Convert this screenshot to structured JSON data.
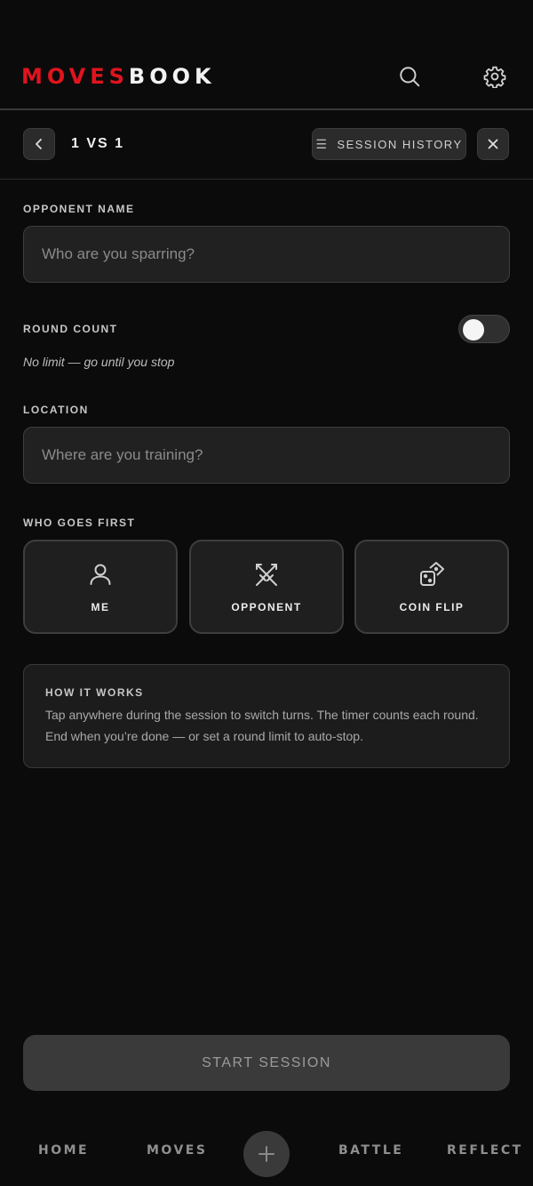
{
  "brand": {
    "part1": "MOVES",
    "part2": "BOOK",
    "accent": "#e0141e"
  },
  "header": {
    "search_icon": "search-icon",
    "settings_icon": "gear-icon"
  },
  "subbar": {
    "title": "1 VS 1",
    "history_label": "SESSION HISTORY",
    "back_icon": "chevron-left-icon",
    "close_icon": "close-icon"
  },
  "form": {
    "opponent": {
      "label": "OPPONENT NAME",
      "placeholder": "Who are you sparring?",
      "value": ""
    },
    "rounds": {
      "label": "ROUND COUNT",
      "enabled": false,
      "hint": "No limit — go until you stop"
    },
    "location": {
      "label": "LOCATION",
      "placeholder": "Where are you training?",
      "value": ""
    },
    "first": {
      "label": "WHO GOES FIRST",
      "options": [
        {
          "label": "ME",
          "icon": "user-icon"
        },
        {
          "label": "OPPONENT",
          "icon": "crossed-swords-icon"
        },
        {
          "label": "COIN FLIP",
          "icon": "dice-icon"
        }
      ]
    }
  },
  "info": {
    "title": "HOW IT WORKS",
    "body": "Tap anywhere during the session to switch turns. The timer counts each round. End when you’re done — or set a round limit to auto-stop."
  },
  "start_label": "START SESSION",
  "bottom_nav": {
    "items": [
      "HOME",
      "MOVES",
      "BATTLE",
      "REFLECT"
    ],
    "fab_icon": "plus-icon"
  }
}
